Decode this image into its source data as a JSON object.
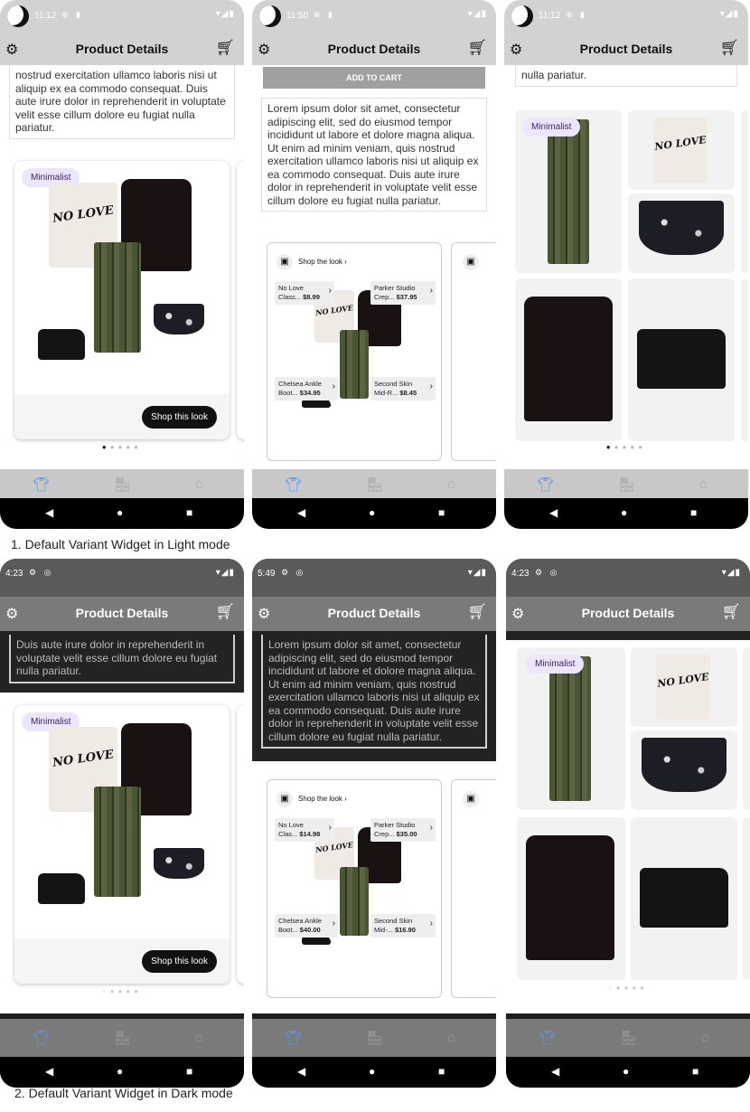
{
  "app": {
    "title": "Product Details",
    "description": "Lorem ipsum dolor sit amet, consectetur adipiscing elit, sed do eiusmod tempor incididunt ut labore et dolore magna aliqua. Ut enim ad minim veniam, quis nostrud exercitation ullamco laboris nisi ut aliquip ex ea commodo consequat. Duis aute irure dolor in reprehenderit in voluptate velit esse cillum dolore eu fugiat nulla pariatur.",
    "desc_tail_a": "nostrud exercitation ullamco laboris nisi ut aliquip ex ea commodo consequat. Duis aute irure dolor in reprehenderit in voluptate velit esse cillum dolore eu fugiat nulla pariatur.",
    "desc_tail_b": "nulla pariatur.",
    "desc_tail_c": "Duis aute irure dolor in reprehenderit in voluptate velit esse cillum dolore eu fugiat nulla pariatur.",
    "add_to_cart": "ADD TO CART",
    "badge": "Minimalist",
    "shop_button": "Shop this look",
    "shop_the_look": "Shop the look",
    "tshirt_text": "NO LOVE"
  },
  "light": {
    "times": [
      "11:12",
      "11:50",
      "11:12"
    ],
    "products": [
      {
        "name": "No Love",
        "sub": "Class...",
        "price": "$8.99"
      },
      {
        "name": "Parker Studio",
        "sub": "Crep...",
        "price": "$37.95"
      },
      {
        "name": "Chelsea Ankle",
        "sub": "Boot...",
        "price": "$34.95"
      },
      {
        "name": "Second Skin",
        "sub": "Mid-R...",
        "price": "$8.45"
      }
    ]
  },
  "dark": {
    "times": [
      "4:23",
      "5:49",
      "4:23"
    ],
    "products": [
      {
        "name": "No Love",
        "sub": "Clas...",
        "price": "$14.98"
      },
      {
        "name": "Parker Studio",
        "sub": "Crep...",
        "price": "$35.00"
      },
      {
        "name": "Chelsea Ankle",
        "sub": "Boot...",
        "price": "$40.00"
      },
      {
        "name": "Second Skin",
        "sub": "Mid-...",
        "price": "$16.90"
      }
    ]
  },
  "captions": {
    "light": "1. Default Variant Widget in Light mode",
    "dark": "2. Default Variant Widget in Dark mode"
  },
  "icons": {
    "gear": "gear-icon",
    "cart": "cart-icon",
    "tshirt": "tshirt-icon",
    "store": "store-icon",
    "home": "home-icon"
  },
  "colors": {
    "accent": "#4d8ef0",
    "badge_bg": "#ece6fb",
    "badge_text": "#3b1d7a"
  }
}
